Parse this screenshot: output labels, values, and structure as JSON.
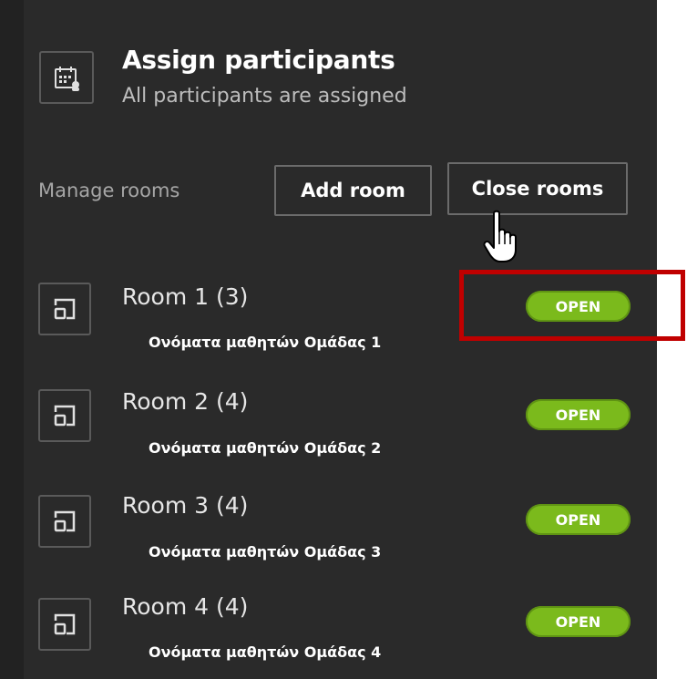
{
  "assign": {
    "title": "Assign participants",
    "subtitle": "All participants are assigned",
    "icon": "calendar-assign-icon"
  },
  "manage": {
    "label": "Manage rooms",
    "add_room_label": "Add room",
    "close_rooms_label": "Close rooms"
  },
  "rooms": [
    {
      "name": "Room 1 (3)",
      "members": "Ονόματα μαθητών Ομάδας 1",
      "status": "OPEN"
    },
    {
      "name": "Room 2 (4)",
      "members": "Ονόματα μαθητών Ομάδας 2",
      "status": "OPEN"
    },
    {
      "name": "Room 3 (4)",
      "members": "Ονόματα μαθητών Ομάδας 3",
      "status": "OPEN"
    },
    {
      "name": "Room 4 (4)",
      "members": "Ονόματα μαθητών Ομάδας 4",
      "status": "OPEN"
    }
  ],
  "colors": {
    "panel_bg": "#2a2a2a",
    "open_green": "#7bba1c",
    "highlight_red": "#c00000"
  }
}
